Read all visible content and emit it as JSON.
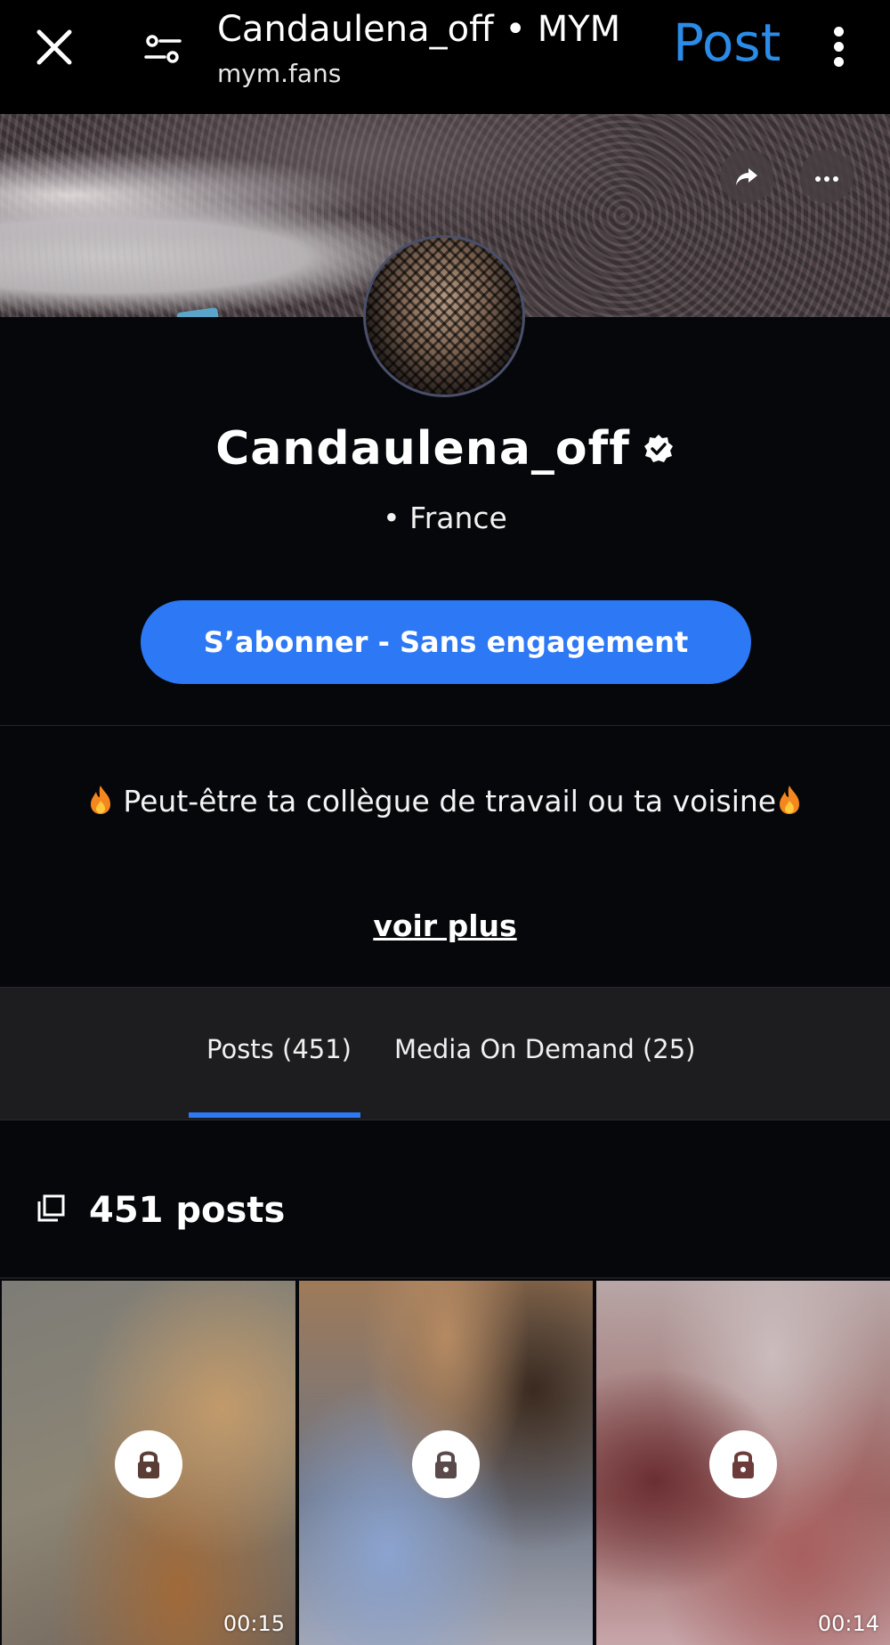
{
  "browser_bar": {
    "title": "Candaulena_off • MYM",
    "url": "mym.fans",
    "post_label": "Post"
  },
  "profile": {
    "name": "Candaulena_off",
    "location": "• France",
    "subscribe_label": "S’abonner - Sans engagement",
    "bio": "Peut-être ta collègue de travail ou ta voisine",
    "see_more_label": "voir plus"
  },
  "tabs": [
    {
      "label": "Posts (451)",
      "active": true
    },
    {
      "label": "Media On Demand (25)",
      "active": false
    }
  ],
  "posts_section": {
    "count_label": "451 posts"
  },
  "grid": [
    {
      "duration": "00:15",
      "locked": true
    },
    {
      "duration": "",
      "locked": true
    },
    {
      "duration": "00:14",
      "locked": true
    }
  ],
  "colors": {
    "accent": "#2d78f5",
    "post_link": "#2b8ce8",
    "background": "#06070b",
    "tabs_background": "#1d1d1f"
  },
  "icons": {
    "close": "close-icon",
    "tune": "tune-icon",
    "kebab": "more-vert-icon",
    "share": "share-icon",
    "more": "more-horiz-icon",
    "verified": "verified-icon",
    "fire": "fire-icon",
    "copy": "copy-icon",
    "lock": "lock-icon"
  }
}
